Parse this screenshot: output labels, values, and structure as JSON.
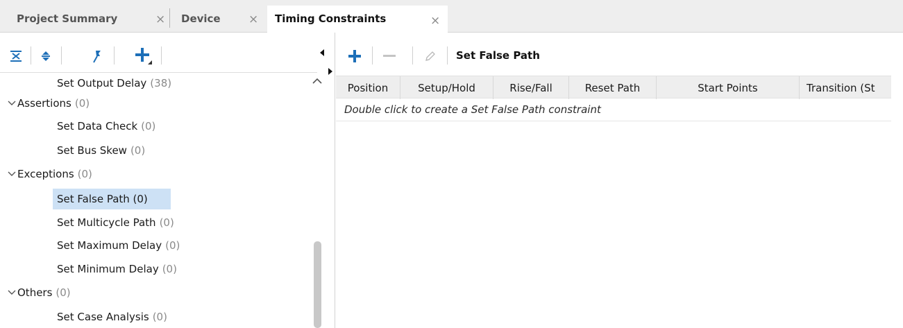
{
  "tabs": [
    {
      "label": "Project Summary",
      "close": "×"
    },
    {
      "label": "Device",
      "close": "×"
    },
    {
      "label": "Timing Constraints",
      "close": "×",
      "active": true
    }
  ],
  "left_toolbar": {
    "icons": [
      "collapse-all-icon",
      "expand-all-icon",
      "pin-icon",
      "add-constraint-icon"
    ]
  },
  "tree": {
    "items": [
      {
        "label": "Set Output Delay",
        "count": "(38)",
        "kind": "child"
      },
      {
        "label": "Assertions",
        "count": "(0)",
        "kind": "parent"
      },
      {
        "label": "Set Data Check",
        "count": "(0)",
        "kind": "child"
      },
      {
        "label": "Set Bus Skew",
        "count": "(0)",
        "kind": "child"
      },
      {
        "label": "Exceptions",
        "count": "(0)",
        "kind": "parent"
      },
      {
        "label": "Set False Path (0)",
        "count": "",
        "kind": "child",
        "selected": true
      },
      {
        "label": "Set Multicycle Path",
        "count": "(0)",
        "kind": "child"
      },
      {
        "label": "Set Maximum Delay",
        "count": "(0)",
        "kind": "child"
      },
      {
        "label": "Set Minimum Delay",
        "count": "(0)",
        "kind": "child"
      },
      {
        "label": "Others",
        "count": "(0)",
        "kind": "parent"
      },
      {
        "label": "Set Case Analysis",
        "count": "(0)",
        "kind": "child"
      }
    ]
  },
  "right_toolbar": {
    "title": "Set False Path",
    "icons": [
      "add-icon",
      "remove-icon",
      "edit-icon"
    ]
  },
  "grid": {
    "columns": [
      "Position",
      "Setup/Hold",
      "Rise/Fall",
      "Reset Path",
      "Start Points",
      "Transition (St"
    ],
    "hint": "Double click to create a Set False Path constraint"
  },
  "colors": {
    "accent": "#1d6fb8",
    "selection": "#cde1f5",
    "tab_bar": "#eeeeee",
    "count_text": "#8a8a8a"
  }
}
